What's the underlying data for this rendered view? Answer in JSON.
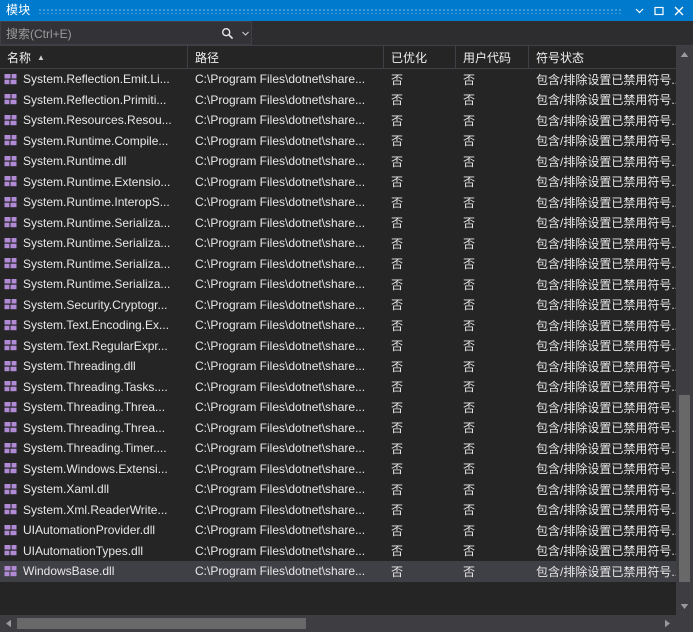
{
  "window": {
    "title": "模块",
    "accent_color": "#007acc",
    "buttons": [
      {
        "name": "dropdown",
        "glyph": "▾",
        "label": "窗口下拉菜单"
      },
      {
        "name": "float",
        "glyph": "□",
        "label": "最大化/浮动"
      },
      {
        "name": "close",
        "glyph": "✕",
        "label": "关闭"
      }
    ]
  },
  "search": {
    "placeholder": "搜索(Ctrl+E)",
    "icon": "search-icon",
    "dropdown_glyph": "▾"
  },
  "grid": {
    "columns": [
      {
        "key": "name",
        "label": "名称",
        "sorted": true,
        "sort_glyph": "▲"
      },
      {
        "key": "path",
        "label": "路径",
        "sorted": false,
        "sort_glyph": ""
      },
      {
        "key": "optimized",
        "label": "已优化",
        "sorted": false,
        "sort_glyph": ""
      },
      {
        "key": "user_code",
        "label": "用户代码",
        "sorted": false,
        "sort_glyph": ""
      },
      {
        "key": "symbol_status",
        "label": "符号状态",
        "sorted": false,
        "sort_glyph": ""
      }
    ],
    "common": {
      "path": "C:\\Program Files\\dotnet\\share...",
      "optimized": "否",
      "user_code": "否",
      "symbol_status": "包含/排除设置已禁用符号..."
    },
    "rows": [
      {
        "name": "System.Reflection.Emit.Li...",
        "path": "C:\\Program Files\\dotnet\\share...",
        "optimized": "否",
        "user_code": "否",
        "symbol_status": "包含/排除设置已禁用符号...",
        "selected": false
      },
      {
        "name": "System.Reflection.Primiti...",
        "path": "C:\\Program Files\\dotnet\\share...",
        "optimized": "否",
        "user_code": "否",
        "symbol_status": "包含/排除设置已禁用符号...",
        "selected": false
      },
      {
        "name": "System.Resources.Resou...",
        "path": "C:\\Program Files\\dotnet\\share...",
        "optimized": "否",
        "user_code": "否",
        "symbol_status": "包含/排除设置已禁用符号...",
        "selected": false
      },
      {
        "name": "System.Runtime.Compile...",
        "path": "C:\\Program Files\\dotnet\\share...",
        "optimized": "否",
        "user_code": "否",
        "symbol_status": "包含/排除设置已禁用符号...",
        "selected": false
      },
      {
        "name": "System.Runtime.dll",
        "path": "C:\\Program Files\\dotnet\\share...",
        "optimized": "否",
        "user_code": "否",
        "symbol_status": "包含/排除设置已禁用符号...",
        "selected": false
      },
      {
        "name": "System.Runtime.Extensio...",
        "path": "C:\\Program Files\\dotnet\\share...",
        "optimized": "否",
        "user_code": "否",
        "symbol_status": "包含/排除设置已禁用符号...",
        "selected": false
      },
      {
        "name": "System.Runtime.InteropS...",
        "path": "C:\\Program Files\\dotnet\\share...",
        "optimized": "否",
        "user_code": "否",
        "symbol_status": "包含/排除设置已禁用符号...",
        "selected": false
      },
      {
        "name": "System.Runtime.Serializa...",
        "path": "C:\\Program Files\\dotnet\\share...",
        "optimized": "否",
        "user_code": "否",
        "symbol_status": "包含/排除设置已禁用符号...",
        "selected": false
      },
      {
        "name": "System.Runtime.Serializa...",
        "path": "C:\\Program Files\\dotnet\\share...",
        "optimized": "否",
        "user_code": "否",
        "symbol_status": "包含/排除设置已禁用符号...",
        "selected": false
      },
      {
        "name": "System.Runtime.Serializa...",
        "path": "C:\\Program Files\\dotnet\\share...",
        "optimized": "否",
        "user_code": "否",
        "symbol_status": "包含/排除设置已禁用符号...",
        "selected": false
      },
      {
        "name": "System.Runtime.Serializa...",
        "path": "C:\\Program Files\\dotnet\\share...",
        "optimized": "否",
        "user_code": "否",
        "symbol_status": "包含/排除设置已禁用符号...",
        "selected": false
      },
      {
        "name": "System.Security.Cryptogr...",
        "path": "C:\\Program Files\\dotnet\\share...",
        "optimized": "否",
        "user_code": "否",
        "symbol_status": "包含/排除设置已禁用符号...",
        "selected": false
      },
      {
        "name": "System.Text.Encoding.Ex...",
        "path": "C:\\Program Files\\dotnet\\share...",
        "optimized": "否",
        "user_code": "否",
        "symbol_status": "包含/排除设置已禁用符号...",
        "selected": false
      },
      {
        "name": "System.Text.RegularExpr...",
        "path": "C:\\Program Files\\dotnet\\share...",
        "optimized": "否",
        "user_code": "否",
        "symbol_status": "包含/排除设置已禁用符号...",
        "selected": false
      },
      {
        "name": "System.Threading.dll",
        "path": "C:\\Program Files\\dotnet\\share...",
        "optimized": "否",
        "user_code": "否",
        "symbol_status": "包含/排除设置已禁用符号...",
        "selected": false
      },
      {
        "name": "System.Threading.Tasks....",
        "path": "C:\\Program Files\\dotnet\\share...",
        "optimized": "否",
        "user_code": "否",
        "symbol_status": "包含/排除设置已禁用符号...",
        "selected": false
      },
      {
        "name": "System.Threading.Threa...",
        "path": "C:\\Program Files\\dotnet\\share...",
        "optimized": "否",
        "user_code": "否",
        "symbol_status": "包含/排除设置已禁用符号...",
        "selected": false
      },
      {
        "name": "System.Threading.Threa...",
        "path": "C:\\Program Files\\dotnet\\share...",
        "optimized": "否",
        "user_code": "否",
        "symbol_status": "包含/排除设置已禁用符号...",
        "selected": false
      },
      {
        "name": "System.Threading.Timer....",
        "path": "C:\\Program Files\\dotnet\\share...",
        "optimized": "否",
        "user_code": "否",
        "symbol_status": "包含/排除设置已禁用符号...",
        "selected": false
      },
      {
        "name": "System.Windows.Extensi...",
        "path": "C:\\Program Files\\dotnet\\share...",
        "optimized": "否",
        "user_code": "否",
        "symbol_status": "包含/排除设置已禁用符号...",
        "selected": false
      },
      {
        "name": "System.Xaml.dll",
        "path": "C:\\Program Files\\dotnet\\share...",
        "optimized": "否",
        "user_code": "否",
        "symbol_status": "包含/排除设置已禁用符号...",
        "selected": false
      },
      {
        "name": "System.Xml.ReaderWrite...",
        "path": "C:\\Program Files\\dotnet\\share...",
        "optimized": "否",
        "user_code": "否",
        "symbol_status": "包含/排除设置已禁用符号...",
        "selected": false
      },
      {
        "name": "UIAutomationProvider.dll",
        "path": "C:\\Program Files\\dotnet\\share...",
        "optimized": "否",
        "user_code": "否",
        "symbol_status": "包含/排除设置已禁用符号...",
        "selected": false
      },
      {
        "name": "UIAutomationTypes.dll",
        "path": "C:\\Program Files\\dotnet\\share...",
        "optimized": "否",
        "user_code": "否",
        "symbol_status": "包含/排除设置已禁用符号...",
        "selected": false
      },
      {
        "name": "WindowsBase.dll",
        "path": "C:\\Program Files\\dotnet\\share...",
        "optimized": "否",
        "user_code": "否",
        "symbol_status": "包含/排除设置已禁用符号...",
        "selected": true
      }
    ],
    "row_icon": "module-icon",
    "row_icon_color": "#b18ad6"
  },
  "scrollbars": {
    "vertical": {
      "up_glyph": "▲",
      "down_glyph": "▼",
      "thumb_top_pct": 62,
      "thumb_height_pct": 35
    },
    "horizontal": {
      "left_glyph": "◀",
      "right_glyph": "▶",
      "thumb_left_pct": 0,
      "thumb_width_pct": 45
    }
  }
}
